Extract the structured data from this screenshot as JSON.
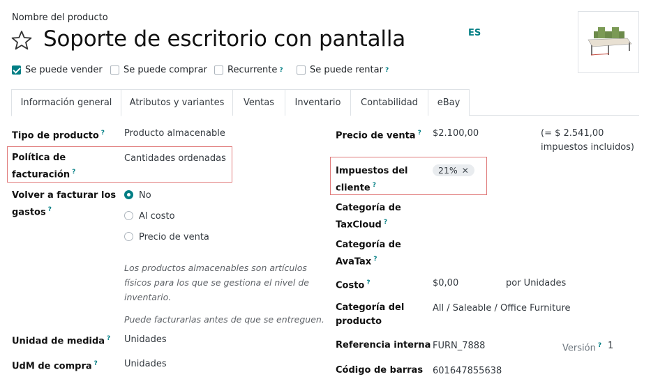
{
  "header": {
    "name_label": "Nombre del producto",
    "product_name": "Soporte de escritorio con pantalla",
    "lang_badge": "ES"
  },
  "checkboxes": [
    {
      "label": "Se puede vender",
      "checked": true,
      "help": ""
    },
    {
      "label": "Se puede comprar",
      "checked": false,
      "help": ""
    },
    {
      "label": "Recurrente",
      "checked": false,
      "help": "?"
    },
    {
      "label": "Se puede rentar",
      "checked": false,
      "help": "?"
    }
  ],
  "tabs": [
    {
      "label": "Información general",
      "active": true
    },
    {
      "label": "Atributos y variantes",
      "active": false
    },
    {
      "label": "Ventas",
      "active": false
    },
    {
      "label": "Inventario",
      "active": false
    },
    {
      "label": "Contabilidad",
      "active": false
    },
    {
      "label": "eBay",
      "active": false
    }
  ],
  "left": {
    "product_type": {
      "label": "Tipo de producto",
      "help": "?",
      "value": "Producto almacenable"
    },
    "invoice_policy": {
      "label_line1": "Política de",
      "label_line2": "facturación",
      "help": "?",
      "value": "Cantidades ordenadas"
    },
    "reinvoice": {
      "label_line1": "Volver a facturar los",
      "label_line2": "gastos",
      "help": "?",
      "options": [
        "No",
        "Al costo",
        "Precio de venta"
      ],
      "selected": "No"
    },
    "help_text_1": [
      "Los productos almacenables son artículos",
      "físicos para los que se gestiona el nivel de",
      "inventario."
    ],
    "help_text_2": "Puede facturarlas antes de que se entreguen.",
    "uom": {
      "label": "Unidad de medida",
      "help": "?",
      "value": "Unidades"
    },
    "purchase_uom": {
      "label": "UdM de compra",
      "help": "?",
      "value": "Unidades"
    }
  },
  "right": {
    "sale_price": {
      "label": "Precio de venta",
      "help": "?",
      "value": "$2.100,00",
      "tax_incl_line1": "(= $ 2.541,00",
      "tax_incl_line2": "impuestos incluidos)"
    },
    "customer_taxes": {
      "label_line1": "Impuestos del",
      "label_line2": "cliente",
      "help": "?",
      "tag": "21%",
      "tag_remove": "✕"
    },
    "taxcloud": {
      "label_line1": "Categoría de",
      "label_line2": "TaxCloud",
      "help": "?"
    },
    "avatax": {
      "label_line1": "Categoría de",
      "label_line2": "AvaTax",
      "help": "?"
    },
    "cost": {
      "label": "Costo",
      "help": "?",
      "value": "$0,00",
      "unit": "por Unidades"
    },
    "category": {
      "label_line1": "Categoría del",
      "label_line2": "producto",
      "value": "All / Saleable / Office Furniture"
    },
    "internal_ref": {
      "label": "Referencia interna",
      "value": "FURN_7888",
      "version_label": "Versión",
      "version_help": "?",
      "version_value": "1"
    },
    "barcode": {
      "label": "Código de barras",
      "value": "601647855638"
    }
  },
  "colors": {
    "accent": "#017e84",
    "highlight_border": "#e07a7a"
  }
}
